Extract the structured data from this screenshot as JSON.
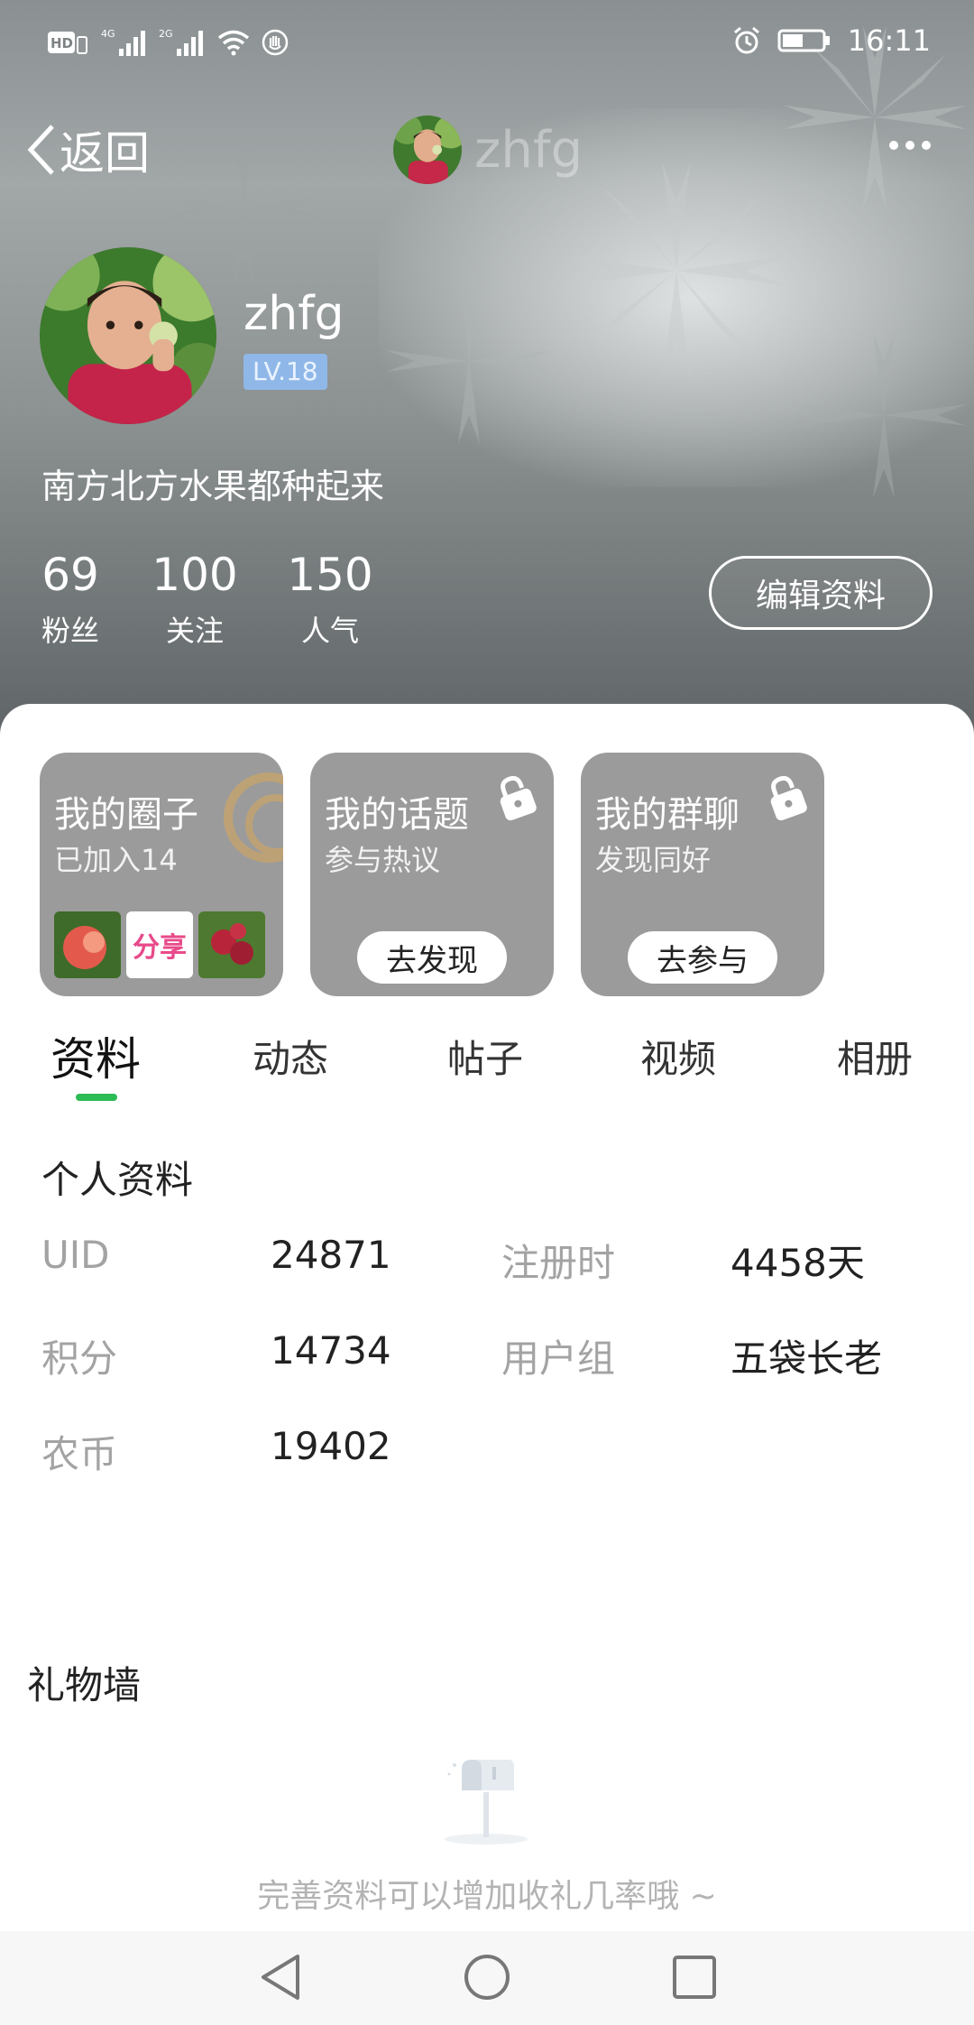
{
  "status_bar": {
    "time": "16:11",
    "network": "4G",
    "network2": "2G",
    "hd": "HD"
  },
  "nav": {
    "back_label": "返回",
    "title": "zhfg"
  },
  "profile": {
    "username": "zhfg",
    "level": "LV.18",
    "bio": "南方北方水果都种起来",
    "stats": [
      {
        "value": "69",
        "label": "粉丝"
      },
      {
        "value": "100",
        "label": "关注"
      },
      {
        "value": "150",
        "label": "人气"
      }
    ],
    "edit_label": "编辑资料"
  },
  "cards": [
    {
      "title": "我的圈子",
      "subtitle": "已加入14",
      "button": ""
    },
    {
      "title": "我的话题",
      "subtitle": "参与热议",
      "button": "去发现"
    },
    {
      "title": "我的群聊",
      "subtitle": "发现同好",
      "button": "去参与"
    }
  ],
  "circle_thumb_text": "分享",
  "tabs": [
    "资料",
    "动态",
    "帖子",
    "视频",
    "相册"
  ],
  "active_tab": "资料",
  "info": {
    "section_title": "个人资料",
    "rows": [
      {
        "label": "UID",
        "value": "24871"
      },
      {
        "label": "注册时",
        "value": "4458天"
      },
      {
        "label": "积分",
        "value": "14734"
      },
      {
        "label": "用户组",
        "value": "五袋长老"
      },
      {
        "label": "农币",
        "value": "19402"
      }
    ]
  },
  "gift_wall": {
    "title": "礼物墙",
    "empty_text": "完善资料可以增加收礼几率哦 ~"
  },
  "colors": {
    "accent": "#2dbb55",
    "level_badge": "#8fb8e8",
    "card_bg": "#9b9b9b"
  },
  "icons": [
    "back-chevron-icon",
    "more-icon",
    "lock-icon",
    "mailbox-icon",
    "alarm-icon",
    "battery-icon",
    "wifi-icon",
    "signal-icon",
    "nav-back-icon",
    "nav-home-icon",
    "nav-recent-icon"
  ]
}
